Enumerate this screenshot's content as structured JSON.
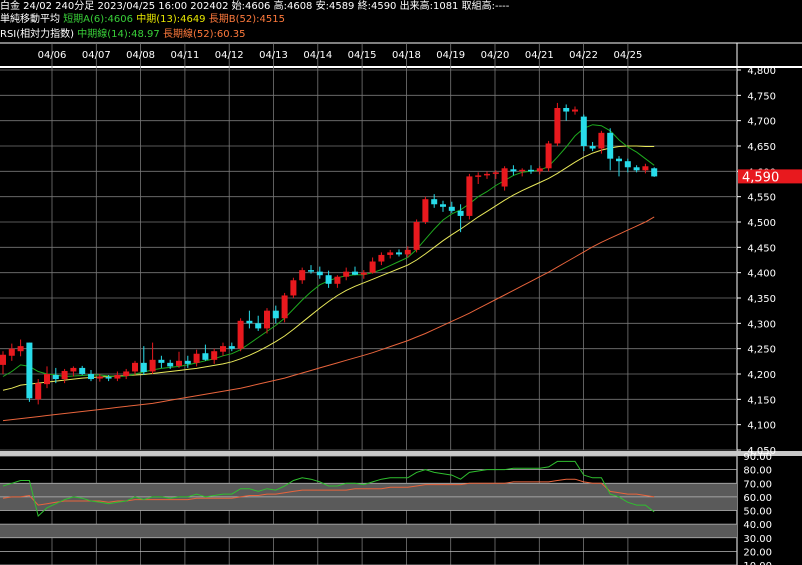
{
  "header": {
    "line1": "白金 24/02 240分足 2023/04/25 16:00 202402 始:4606 高:4608 安:4589 終:4590 出来高:1081 取組高:----",
    "ma_label": "単純移動平均",
    "ma_short": "短期A(6):4606",
    "ma_mid": "中期(13):4649",
    "ma_long": "長期B(52):4515",
    "rsi_label": "RSI(相対力指数)",
    "rsi_mid": "中期線(14):48.97",
    "rsi_long": "長期線(52):60.35"
  },
  "colors": {
    "background": "#000000",
    "up_candle": "#e8191e",
    "down_candle": "#28dcea",
    "ma_short": "#1faa1f",
    "ma_mid": "#e8e85a",
    "ma_long": "#e8643c",
    "rsi_mid": "#2fbf2f",
    "rsi_long": "#e8643c",
    "current_price_bg": "#e8191e",
    "ma_short_text": "#39d039",
    "ma_mid_text": "#e8e800",
    "ma_long_text": "#ff7a3c"
  },
  "chart_data": [
    {
      "type": "candlestick",
      "date_labels": [
        "04/06",
        "04/07",
        "04/08",
        "04/11",
        "04/12",
        "04/13",
        "04/14",
        "04/15",
        "04/18",
        "04/19",
        "04/20",
        "04/21",
        "04/22",
        "04/25"
      ],
      "ylim": [
        4050,
        4800
      ],
      "yticks": [
        "4,800",
        "4,750",
        "4,700",
        "4,650",
        "4,600",
        "4,550",
        "4,500",
        "4,450",
        "4,400",
        "4,350",
        "4,300",
        "4,250",
        "4,200",
        "4,150",
        "4,100",
        "4,050"
      ],
      "current_price": "4,590",
      "candles": [
        {
          "o": 4218,
          "h": 4245,
          "l": 4200,
          "c": 4238
        },
        {
          "o": 4236,
          "h": 4260,
          "l": 4226,
          "c": 4250
        },
        {
          "o": 4245,
          "h": 4268,
          "l": 4235,
          "c": 4255
        },
        {
          "o": 4262,
          "h": 4262,
          "l": 4145,
          "c": 4152
        },
        {
          "o": 4150,
          "h": 4190,
          "l": 4140,
          "c": 4182
        },
        {
          "o": 4180,
          "h": 4215,
          "l": 4172,
          "c": 4200
        },
        {
          "o": 4198,
          "h": 4212,
          "l": 4182,
          "c": 4190
        },
        {
          "o": 4190,
          "h": 4210,
          "l": 4182,
          "c": 4206
        },
        {
          "o": 4205,
          "h": 4215,
          "l": 4195,
          "c": 4212
        },
        {
          "o": 4212,
          "h": 4216,
          "l": 4198,
          "c": 4200
        },
        {
          "o": 4200,
          "h": 4208,
          "l": 4186,
          "c": 4190
        },
        {
          "o": 4191,
          "h": 4200,
          "l": 4185,
          "c": 4195
        },
        {
          "o": 4194,
          "h": 4198,
          "l": 4186,
          "c": 4192
        },
        {
          "o": 4191,
          "h": 4205,
          "l": 4186,
          "c": 4198
        },
        {
          "o": 4196,
          "h": 4210,
          "l": 4190,
          "c": 4205
        },
        {
          "o": 4205,
          "h": 4226,
          "l": 4198,
          "c": 4222
        },
        {
          "o": 4222,
          "h": 4255,
          "l": 4198,
          "c": 4204
        },
        {
          "o": 4205,
          "h": 4262,
          "l": 4200,
          "c": 4228
        },
        {
          "o": 4228,
          "h": 4236,
          "l": 4212,
          "c": 4222
        },
        {
          "o": 4222,
          "h": 4228,
          "l": 4210,
          "c": 4215
        },
        {
          "o": 4216,
          "h": 4244,
          "l": 4212,
          "c": 4226
        },
        {
          "o": 4226,
          "h": 4236,
          "l": 4212,
          "c": 4220
        },
        {
          "o": 4222,
          "h": 4248,
          "l": 4215,
          "c": 4240
        },
        {
          "o": 4241,
          "h": 4258,
          "l": 4226,
          "c": 4228
        },
        {
          "o": 4228,
          "h": 4250,
          "l": 4220,
          "c": 4245
        },
        {
          "o": 4244,
          "h": 4262,
          "l": 4236,
          "c": 4255
        },
        {
          "o": 4255,
          "h": 4262,
          "l": 4245,
          "c": 4250
        },
        {
          "o": 4250,
          "h": 4310,
          "l": 4245,
          "c": 4305
        },
        {
          "o": 4305,
          "h": 4325,
          "l": 4290,
          "c": 4300
        },
        {
          "o": 4300,
          "h": 4315,
          "l": 4285,
          "c": 4290
        },
        {
          "o": 4290,
          "h": 4330,
          "l": 4280,
          "c": 4325
        },
        {
          "o": 4325,
          "h": 4335,
          "l": 4300,
          "c": 4310
        },
        {
          "o": 4310,
          "h": 4360,
          "l": 4302,
          "c": 4355
        },
        {
          "o": 4355,
          "h": 4390,
          "l": 4350,
          "c": 4385
        },
        {
          "o": 4385,
          "h": 4410,
          "l": 4378,
          "c": 4405
        },
        {
          "o": 4405,
          "h": 4415,
          "l": 4398,
          "c": 4402
        },
        {
          "o": 4402,
          "h": 4412,
          "l": 4388,
          "c": 4395
        },
        {
          "o": 4395,
          "h": 4404,
          "l": 4370,
          "c": 4378
        },
        {
          "o": 4378,
          "h": 4395,
          "l": 4370,
          "c": 4392
        },
        {
          "o": 4392,
          "h": 4410,
          "l": 4385,
          "c": 4402
        },
        {
          "o": 4402,
          "h": 4412,
          "l": 4395,
          "c": 4396
        },
        {
          "o": 4396,
          "h": 4405,
          "l": 4388,
          "c": 4400
        },
        {
          "o": 4400,
          "h": 4430,
          "l": 4398,
          "c": 4422
        },
        {
          "o": 4422,
          "h": 4440,
          "l": 4415,
          "c": 4435
        },
        {
          "o": 4435,
          "h": 4445,
          "l": 4428,
          "c": 4440
        },
        {
          "o": 4440,
          "h": 4446,
          "l": 4432,
          "c": 4436
        },
        {
          "o": 4436,
          "h": 4452,
          "l": 4430,
          "c": 4445
        },
        {
          "o": 4445,
          "h": 4505,
          "l": 4440,
          "c": 4500
        },
        {
          "o": 4500,
          "h": 4550,
          "l": 4496,
          "c": 4545
        },
        {
          "o": 4545,
          "h": 4555,
          "l": 4528,
          "c": 4535
        },
        {
          "o": 4535,
          "h": 4542,
          "l": 4520,
          "c": 4530
        },
        {
          "o": 4530,
          "h": 4540,
          "l": 4518,
          "c": 4522
        },
        {
          "o": 4522,
          "h": 4535,
          "l": 4480,
          "c": 4512
        },
        {
          "o": 4512,
          "h": 4595,
          "l": 4505,
          "c": 4590
        },
        {
          "o": 4590,
          "h": 4598,
          "l": 4575,
          "c": 4592
        },
        {
          "o": 4592,
          "h": 4600,
          "l": 4585,
          "c": 4595
        },
        {
          "o": 4595,
          "h": 4602,
          "l": 4585,
          "c": 4598
        },
        {
          "o": 4570,
          "h": 4610,
          "l": 4562,
          "c": 4606
        },
        {
          "o": 4604,
          "h": 4612,
          "l": 4592,
          "c": 4600
        },
        {
          "o": 4600,
          "h": 4606,
          "l": 4590,
          "c": 4603
        },
        {
          "o": 4603,
          "h": 4612,
          "l": 4595,
          "c": 4600
        },
        {
          "o": 4600,
          "h": 4610,
          "l": 4594,
          "c": 4606
        },
        {
          "o": 4606,
          "h": 4660,
          "l": 4600,
          "c": 4655
        },
        {
          "o": 4655,
          "h": 4735,
          "l": 4650,
          "c": 4725
        },
        {
          "o": 4725,
          "h": 4732,
          "l": 4700,
          "c": 4718
        },
        {
          "o": 4718,
          "h": 4728,
          "l": 4712,
          "c": 4722
        },
        {
          "o": 4708,
          "h": 4712,
          "l": 4640,
          "c": 4650
        },
        {
          "o": 4650,
          "h": 4658,
          "l": 4640,
          "c": 4645
        },
        {
          "o": 4645,
          "h": 4680,
          "l": 4635,
          "c": 4676
        },
        {
          "o": 4676,
          "h": 4685,
          "l": 4602,
          "c": 4625
        },
        {
          "o": 4625,
          "h": 4630,
          "l": 4590,
          "c": 4620
        },
        {
          "o": 4620,
          "h": 4625,
          "l": 4598,
          "c": 4608
        },
        {
          "o": 4608,
          "h": 4612,
          "l": 4598,
          "c": 4602
        },
        {
          "o": 4602,
          "h": 4615,
          "l": 4596,
          "c": 4610
        },
        {
          "o": 4606,
          "h": 4608,
          "l": 4589,
          "c": 4590
        }
      ],
      "ma_short": [
        4195,
        4205,
        4218,
        4215,
        4205,
        4200,
        4198,
        4195,
        4196,
        4197,
        4198,
        4198,
        4196,
        4195,
        4196,
        4200,
        4204,
        4208,
        4211,
        4213,
        4215,
        4218,
        4222,
        4226,
        4230,
        4236,
        4240,
        4248,
        4260,
        4272,
        4284,
        4296,
        4310,
        4328,
        4346,
        4362,
        4376,
        4384,
        4390,
        4394,
        4396,
        4396,
        4400,
        4406,
        4414,
        4422,
        4430,
        4446,
        4466,
        4486,
        4504,
        4516,
        4524,
        4536,
        4550,
        4560,
        4572,
        4582,
        4592,
        4598,
        4600,
        4602,
        4610,
        4628,
        4648,
        4670,
        4685,
        4692,
        4690,
        4680,
        4662,
        4648,
        4638,
        4625,
        4612
      ],
      "ma_mid": [
        4168,
        4172,
        4178,
        4180,
        4182,
        4184,
        4186,
        4188,
        4190,
        4192,
        4193,
        4194,
        4195,
        4196,
        4197,
        4198,
        4199,
        4201,
        4203,
        4205,
        4207,
        4209,
        4211,
        4214,
        4217,
        4220,
        4224,
        4230,
        4237,
        4245,
        4254,
        4264,
        4275,
        4288,
        4302,
        4316,
        4330,
        4343,
        4355,
        4365,
        4373,
        4380,
        4387,
        4394,
        4401,
        4408,
        4415,
        4425,
        4437,
        4450,
        4463,
        4475,
        4486,
        4498,
        4510,
        4521,
        4532,
        4543,
        4553,
        4562,
        4570,
        4578,
        4586,
        4596,
        4607,
        4618,
        4628,
        4636,
        4642,
        4646,
        4649,
        4650,
        4650,
        4649,
        4649
      ],
      "ma_long": [
        4108,
        4110,
        4112,
        4114,
        4116,
        4118,
        4120,
        4122,
        4124,
        4126,
        4128,
        4130,
        4132,
        4134,
        4136,
        4138,
        4140,
        4142,
        4145,
        4148,
        4151,
        4154,
        4157,
        4160,
        4163,
        4166,
        4169,
        4172,
        4176,
        4180,
        4184,
        4188,
        4192,
        4197,
        4202,
        4207,
        4212,
        4217,
        4222,
        4227,
        4232,
        4237,
        4242,
        4248,
        4254,
        4260,
        4266,
        4273,
        4280,
        4288,
        4296,
        4304,
        4312,
        4320,
        4329,
        4338,
        4347,
        4356,
        4365,
        4374,
        4383,
        4392,
        4401,
        4411,
        4421,
        4431,
        4441,
        4451,
        4460,
        4468,
        4476,
        4484,
        4492,
        4500,
        4510
      ]
    },
    {
      "type": "line",
      "title": "RSI(相対力指数)",
      "ylim": [
        10,
        90
      ],
      "yticks": [
        "90.00",
        "80.00",
        "70.00",
        "60.00",
        "50.00",
        "40.00",
        "30.00",
        "20.00",
        "10.00"
      ],
      "bands": [
        [
          50,
          70
        ],
        [
          30,
          40
        ]
      ],
      "series": [
        {
          "name": "中期線(14)",
          "values": [
            68,
            70,
            72,
            72,
            46,
            52,
            55,
            58,
            60,
            59,
            57,
            56,
            55,
            56,
            57,
            60,
            58,
            60,
            60,
            59,
            60,
            60,
            62,
            60,
            61,
            62,
            62,
            66,
            66,
            64,
            66,
            65,
            68,
            72,
            74,
            73,
            71,
            68,
            68,
            70,
            70,
            69,
            71,
            73,
            74,
            74,
            74,
            78,
            80,
            78,
            77,
            76,
            73,
            78,
            79,
            80,
            80,
            80,
            81,
            81,
            81,
            81,
            82,
            86,
            86,
            86,
            76,
            74,
            74,
            62,
            60,
            56,
            54,
            54,
            49
          ]
        },
        {
          "name": "長期線(52)",
          "values": [
            59,
            60,
            60,
            61,
            54,
            55,
            56,
            57,
            57,
            57,
            57,
            57,
            56,
            57,
            57,
            58,
            58,
            58,
            58,
            58,
            58,
            58,
            59,
            59,
            59,
            59,
            59,
            60,
            61,
            61,
            62,
            62,
            63,
            64,
            65,
            65,
            65,
            65,
            65,
            65,
            66,
            66,
            66,
            66,
            67,
            67,
            67,
            68,
            69,
            69,
            69,
            69,
            69,
            70,
            70,
            70,
            70,
            70,
            71,
            71,
            71,
            71,
            71,
            72,
            73,
            73,
            71,
            70,
            70,
            64,
            63,
            62,
            62,
            61,
            60
          ]
        }
      ]
    }
  ]
}
